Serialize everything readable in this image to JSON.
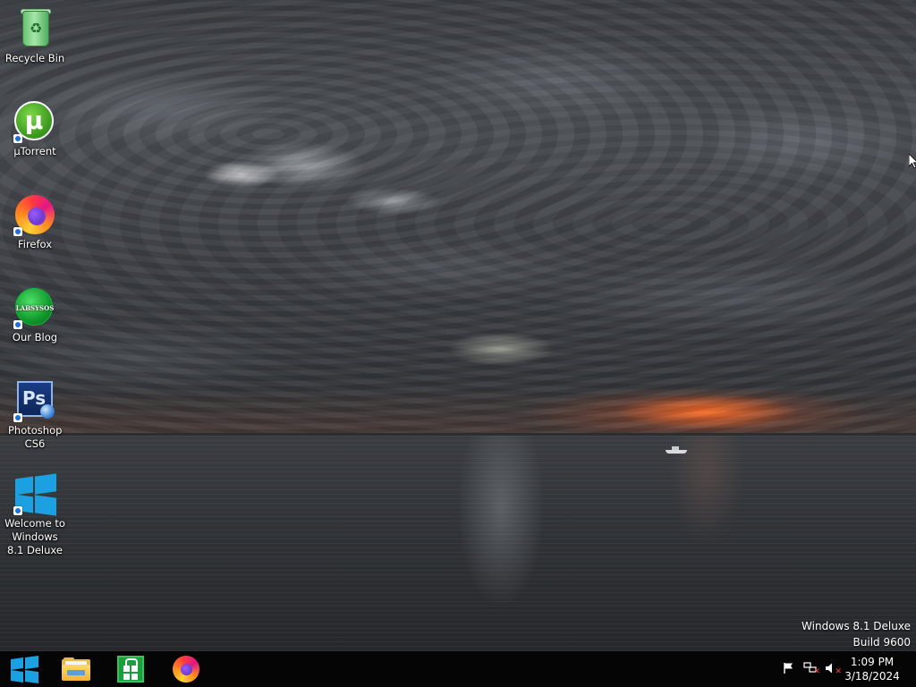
{
  "desktop": {
    "icons": [
      {
        "label": "Recycle Bin",
        "icon": "recycle-bin-icon"
      },
      {
        "label": "µTorrent",
        "icon": "utorrent-icon"
      },
      {
        "label": "Firefox",
        "icon": "firefox-icon"
      },
      {
        "label": "Our Blog",
        "icon": "blog-icon",
        "badge_text": "LABSYSOS"
      },
      {
        "label": "Photoshop CS6",
        "icon": "photoshop-icon",
        "badge_text": "Ps"
      },
      {
        "label": "Welcome to Windows 8.1 Deluxe",
        "icon": "windows-logo-icon"
      }
    ],
    "watermark": {
      "line1": "Windows 8.1 Deluxe",
      "line2": "Build 9600"
    }
  },
  "taskbar": {
    "start": {
      "icon": "start-windows-icon"
    },
    "pinned": [
      {
        "name": "File Explorer",
        "icon": "file-explorer-icon"
      },
      {
        "name": "Store",
        "icon": "store-icon"
      },
      {
        "name": "Firefox",
        "icon": "firefox-icon"
      }
    ],
    "tray": {
      "icons": [
        "action-center-flag-icon",
        "network-disconnected-icon",
        "volume-muted-icon"
      ],
      "time": "1:09 PM",
      "date": "3/18/2024"
    }
  },
  "colors": {
    "accent": "#1ba1e2",
    "taskbar": "#050506",
    "sunset": "#ff6e28"
  }
}
